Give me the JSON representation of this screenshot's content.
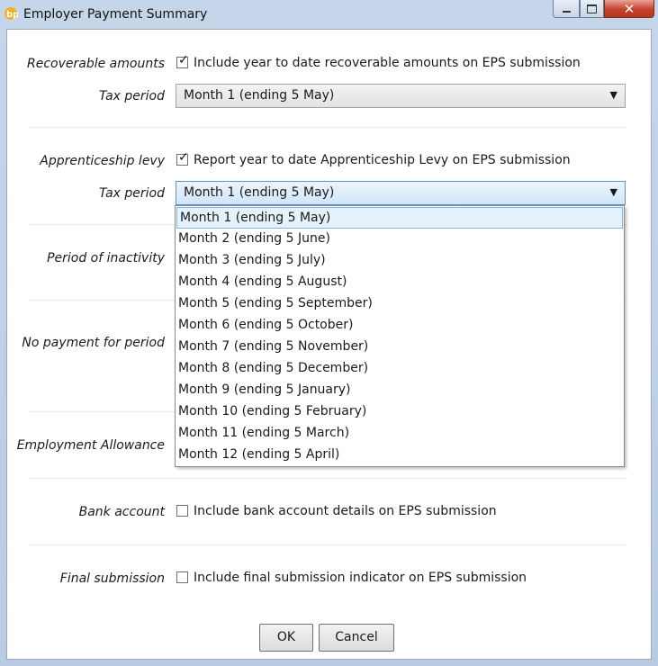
{
  "window": {
    "title": "Employer Payment Summary"
  },
  "recoverable": {
    "label": "Recoverable amounts",
    "checkbox_text": "Include year to date recoverable amounts on EPS submission",
    "checked": true,
    "tax_period_label": "Tax period",
    "tax_period_value": "Month 1 (ending 5 May)"
  },
  "levy": {
    "label": "Apprenticeship levy",
    "checkbox_text": "Report year to date Apprenticeship Levy on EPS submission",
    "checked": true,
    "tax_period_label": "Tax period",
    "tax_period_value": "Month 1 (ending 5 May)"
  },
  "dropdown": {
    "options": [
      "Month 1 (ending 5 May)",
      "Month 2 (ending 5 June)",
      "Month 3 (ending 5 July)",
      "Month 4 (ending 5 August)",
      "Month 5 (ending 5 September)",
      "Month 6 (ending 5 October)",
      "Month 7 (ending 5 November)",
      "Month 8 (ending 5 December)",
      "Month 9 (ending 5 January)",
      "Month 10 (ending 5 February)",
      "Month 11 (ending 5 March)",
      "Month 12 (ending 5 April)"
    ],
    "selected_index": 0
  },
  "inactivity": {
    "label": "Period of inactivity"
  },
  "no_payment": {
    "label": "No payment for period"
  },
  "allowance": {
    "label": "Employment Allowance"
  },
  "bank": {
    "label": "Bank account",
    "checkbox_text": "Include bank account details on EPS submission",
    "checked": false
  },
  "final": {
    "label": "Final submission",
    "checkbox_text": "Include final submission indicator on EPS submission",
    "checked": false
  },
  "buttons": {
    "ok": "OK",
    "cancel": "Cancel"
  },
  "icons": {
    "app": "bp-logo-icon",
    "minimize": "minimize-icon",
    "maximize": "maximize-icon",
    "close": "close-icon",
    "dropdown": "chevron-down-icon"
  },
  "colors": {
    "accent": "#5b95c9",
    "close_button": "#c7412c",
    "selection": "#e5f1fb"
  }
}
